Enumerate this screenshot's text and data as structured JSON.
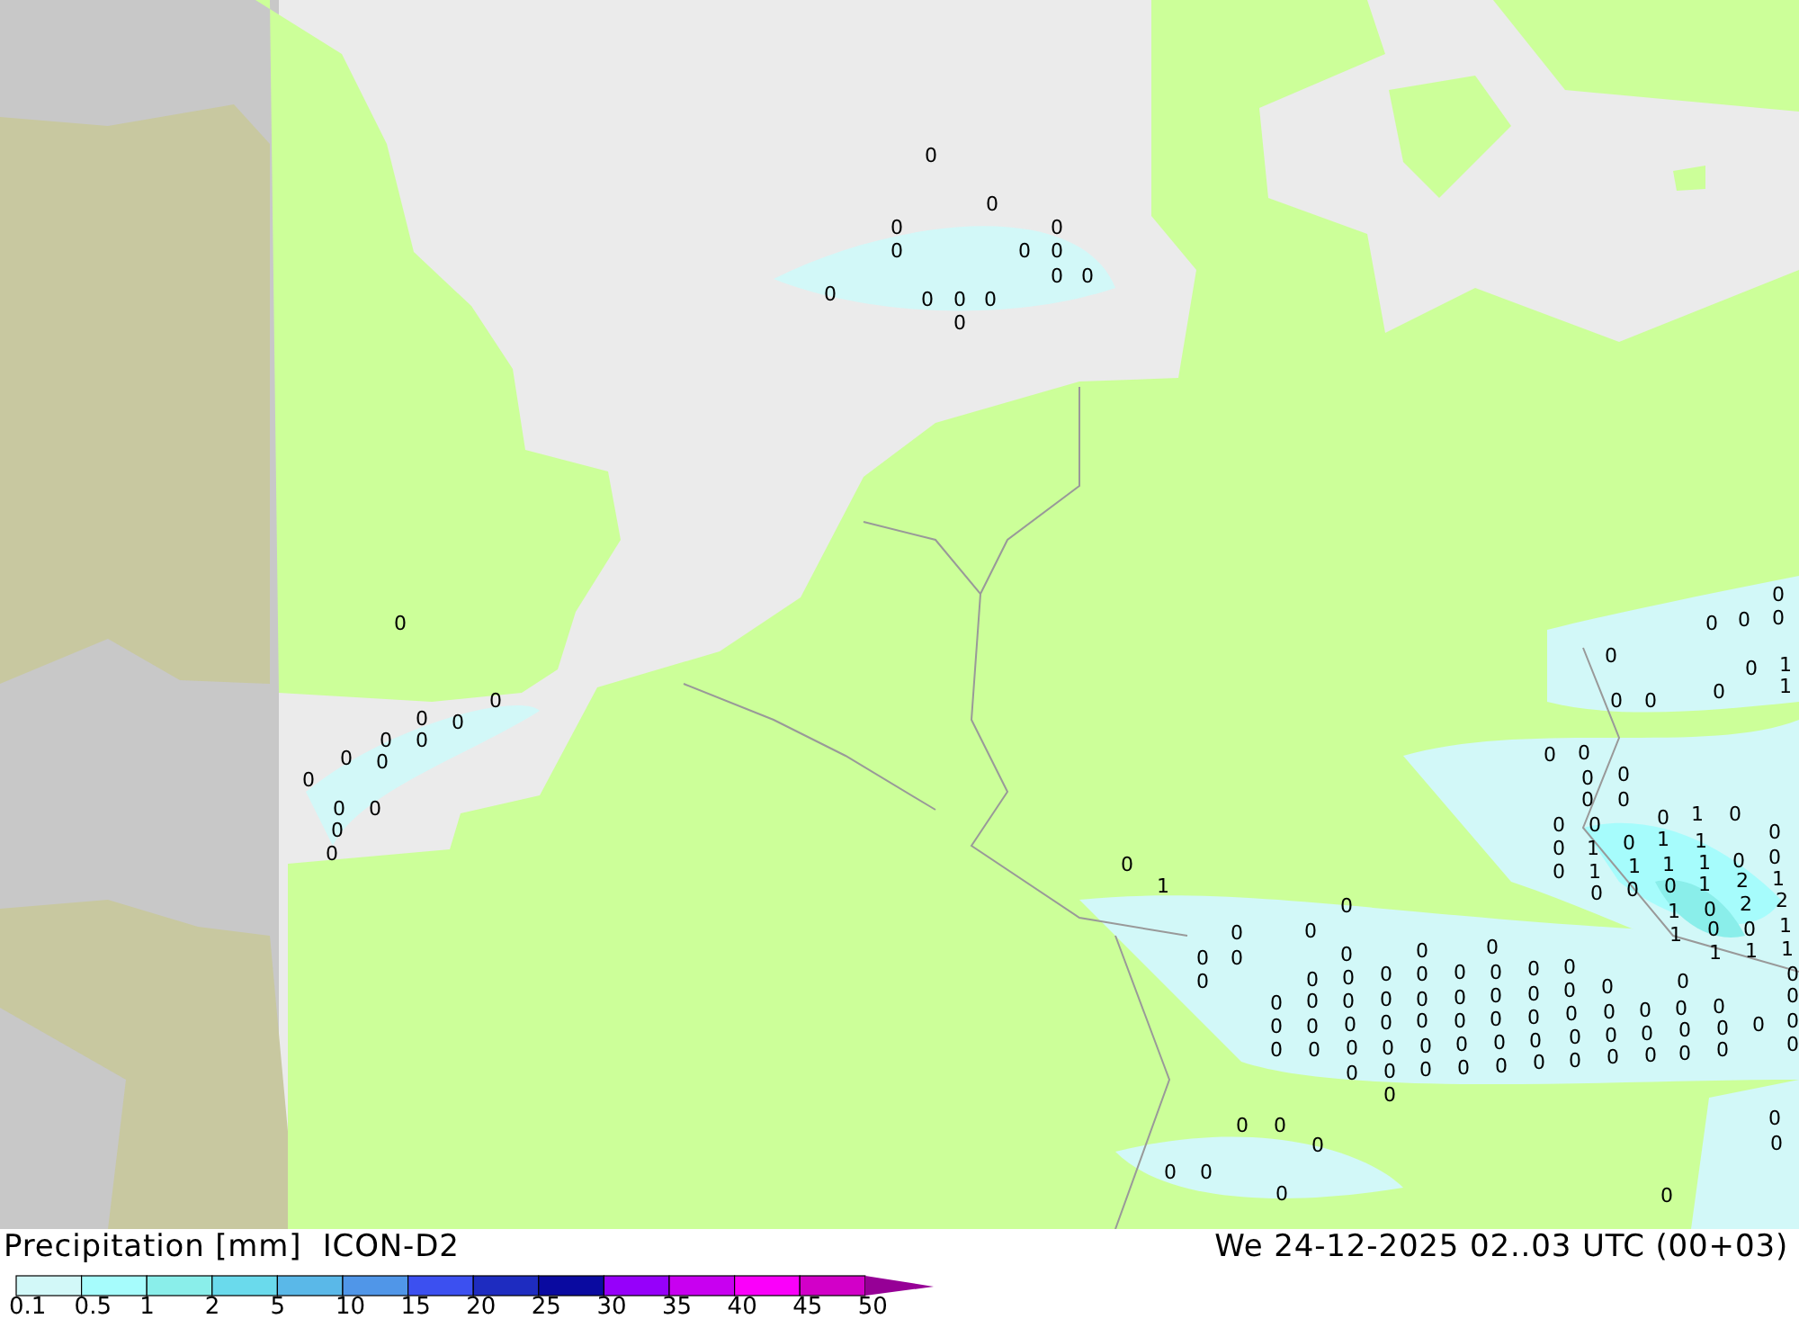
{
  "map": {
    "labels": [
      "0",
      "0",
      "0",
      "0",
      "0",
      "0",
      "0",
      "0",
      "0",
      "0",
      "0",
      "0",
      "0",
      "0",
      "0",
      "0",
      "0",
      "0",
      "0",
      "0",
      "0",
      "0",
      "0",
      "0",
      "0",
      "0",
      "0",
      "0",
      "0",
      "0",
      "0",
      "0",
      "0",
      "0",
      "0",
      "0",
      "1",
      "1",
      "0",
      "0",
      "0",
      "0",
      "0",
      "0",
      "0",
      "0",
      "0",
      "1",
      "0",
      "1",
      "0",
      "1",
      "0",
      "0",
      "0",
      "1",
      "1",
      "0",
      "0",
      "1",
      "1",
      "1",
      "0",
      "0",
      "0",
      "1",
      "2",
      "1",
      "1",
      "0",
      "2",
      "2",
      "1",
      "0",
      "0",
      "1",
      "1",
      "1",
      "1",
      "0",
      "1",
      "0",
      "0",
      "0",
      "0",
      "0",
      "0",
      "0",
      "0",
      "0",
      "0",
      "0",
      "0",
      "0",
      "0",
      "0",
      "0",
      "0",
      "0",
      "0",
      "0",
      "0",
      "0",
      "0",
      "0",
      "0",
      "0",
      "0",
      "0",
      "0",
      "0",
      "0",
      "0",
      "0",
      "0",
      "0",
      "0",
      "0",
      "0",
      "0",
      "0",
      "0",
      "0",
      "0",
      "0",
      "0",
      "0",
      "0",
      "0",
      "0",
      "0",
      "0",
      "0",
      "0",
      "0",
      "0",
      "0",
      "0",
      "0",
      "0",
      "0",
      "0",
      "0",
      "0",
      "0",
      "0",
      "0",
      "0",
      "0",
      "0",
      "0",
      "0",
      "0",
      "0",
      "0",
      "0",
      "0",
      "0",
      "0",
      "0",
      "0"
    ]
  },
  "legend": {
    "title": "Precipitation [mm]  ICON-D2",
    "datetime": "We 24-12-2025 02..03 UTC (00+03)",
    "bins": [
      {
        "color": "#d2f8f8"
      },
      {
        "color": "#a6fcfc"
      },
      {
        "color": "#8aeeea"
      },
      {
        "color": "#6adaec"
      },
      {
        "color": "#5ab8e8"
      },
      {
        "color": "#5096e8"
      },
      {
        "color": "#3c50f0"
      },
      {
        "color": "#1e2cc0"
      },
      {
        "color": "#0a0aa0"
      },
      {
        "color": "#9600fa"
      },
      {
        "color": "#c800f0"
      },
      {
        "color": "#fa00fa"
      },
      {
        "color": "#d200c8"
      },
      {
        "kind": "arrow",
        "color": "#960096"
      }
    ],
    "ticks": [
      "0.1",
      "0.5",
      "1",
      "2",
      "5",
      "10",
      "15",
      "20",
      "25",
      "30",
      "35",
      "40",
      "45",
      "50"
    ]
  }
}
